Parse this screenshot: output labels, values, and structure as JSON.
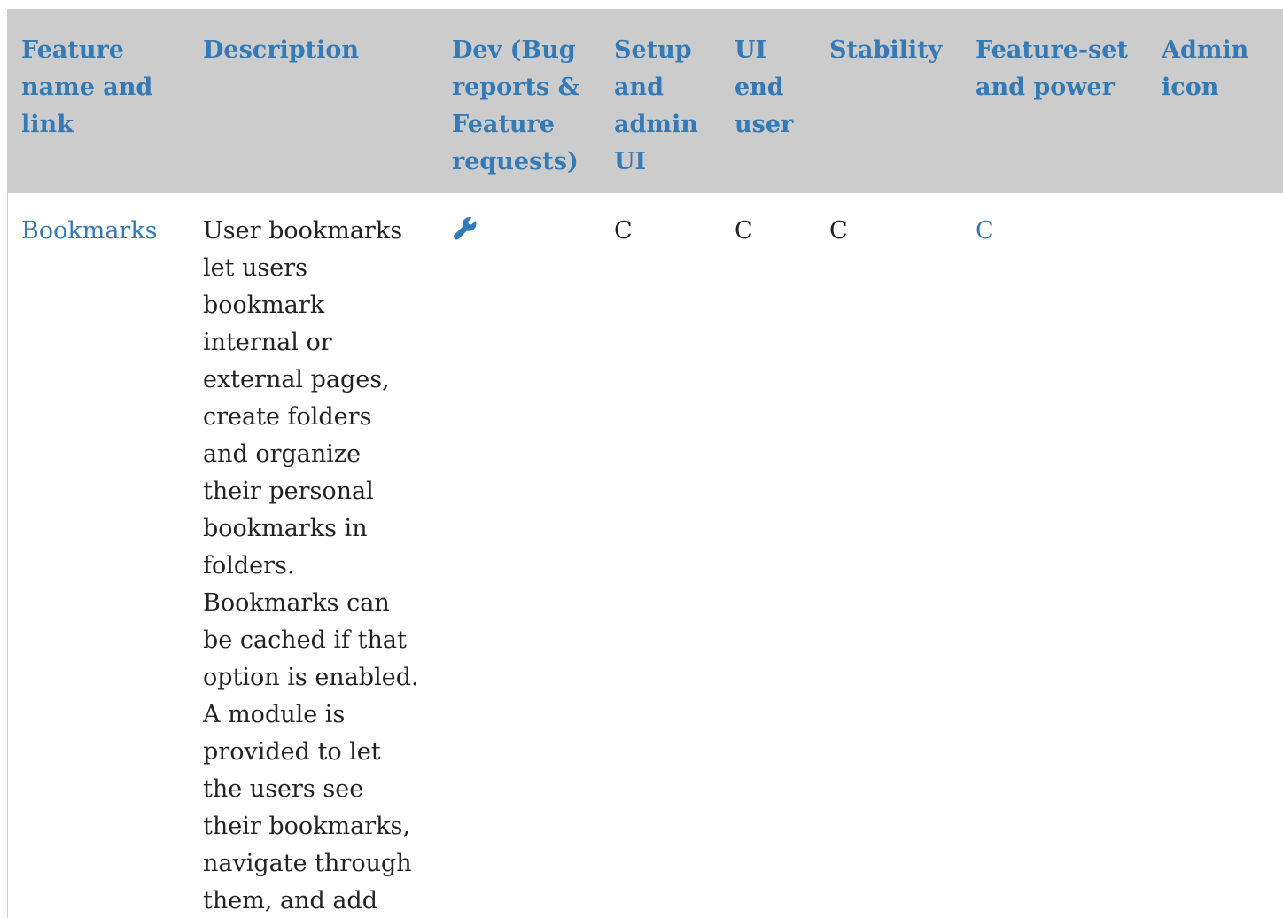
{
  "table": {
    "headers": [
      "Feature name and link",
      "Description",
      "Dev (Bug reports & Feature requests)",
      "Setup and admin UI",
      "UI end user",
      "Stability",
      "Feature-set and power",
      "Admin icon"
    ],
    "rows": [
      {
        "name": "Bookmarks",
        "description": "User bookmarks let users bookmark internal or external pages, create folders and organize their personal bookmarks in folders. Bookmarks can be cached if that option is enabled. A module is provided to let the users see their bookmarks, navigate through them, and add new bookmarks.",
        "dev_icon": "wrench-icon",
        "setup_admin_ui": "C",
        "ui_end_user": "C",
        "stability": "C",
        "feature_set": "C",
        "admin_icon": ""
      }
    ]
  },
  "colors": {
    "header_bg": "#cccccc",
    "link": "#337ab7",
    "text": "#222222"
  }
}
